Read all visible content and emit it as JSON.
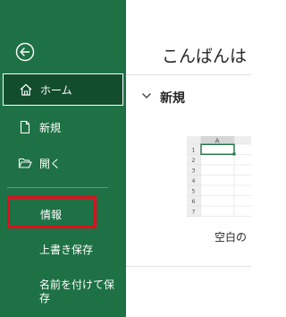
{
  "sidebar": {
    "back": {
      "icon": "back-arrow-icon"
    },
    "items": [
      {
        "label": "ホーム",
        "icon": "home-icon"
      },
      {
        "label": "新規",
        "icon": "new-document-icon"
      },
      {
        "label": "開く",
        "icon": "open-folder-icon"
      },
      {
        "label": "情報"
      },
      {
        "label": "上書き保存"
      },
      {
        "label": "名前を付けて保\n存"
      }
    ]
  },
  "main": {
    "greeting": "こんばんは",
    "new_section": {
      "title": "新規",
      "icon": "chevron-down-icon"
    },
    "templates": [
      {
        "label": "空白の",
        "thumbnail": {
          "column_header": "A",
          "row_numbers": [
            "1",
            "2",
            "3",
            "4",
            "5",
            "6",
            "7"
          ]
        }
      }
    ]
  },
  "colors": {
    "sidebar_bg": "#1e7145",
    "selected_bg": "#124e2e",
    "highlight_border": "#e00d1d"
  }
}
